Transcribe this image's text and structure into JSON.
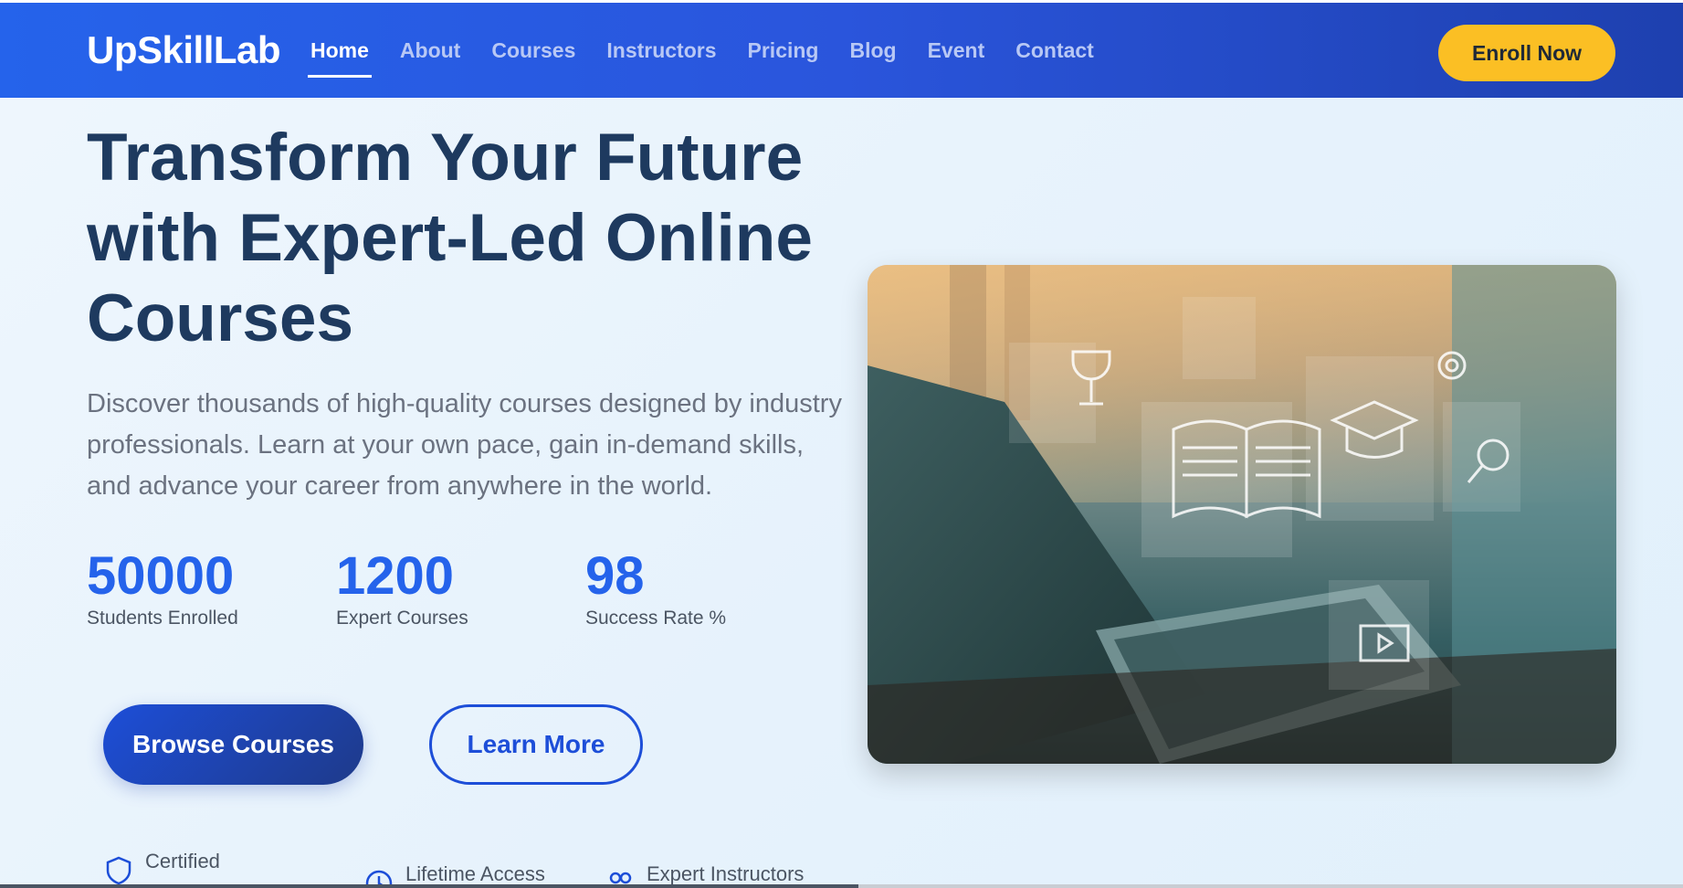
{
  "brand": "UpSkillLab",
  "nav": {
    "items": [
      "Home",
      "About",
      "Courses",
      "Instructors",
      "Pricing",
      "Blog",
      "Event",
      "Contact"
    ],
    "active": "Home",
    "enroll_label": "Enroll Now"
  },
  "hero": {
    "title": "Transform Your Future with Expert-Led Online Courses",
    "description": "Discover thousands of high-quality courses designed by industry professionals. Learn at your own pace, gain in-demand skills, and advance your career from anywhere in the world.",
    "stats": [
      {
        "value": "50000",
        "label": "Students Enrolled"
      },
      {
        "value": "1200",
        "label": "Expert Courses"
      },
      {
        "value": "98",
        "label": "Success Rate %"
      }
    ],
    "primary_button": "Browse Courses",
    "secondary_button": "Learn More"
  },
  "features": [
    {
      "label": "Certified",
      "icon": "shield-icon"
    },
    {
      "label": "Lifetime Access",
      "icon": "clock-icon"
    },
    {
      "label": "Expert Instructors",
      "icon": "users-icon"
    }
  ],
  "colors": {
    "nav_start": "#2563eb",
    "nav_end": "#1e40af",
    "accent": "#fbbf24",
    "heading": "#1e3a5f",
    "stat_value": "#2563eb"
  }
}
